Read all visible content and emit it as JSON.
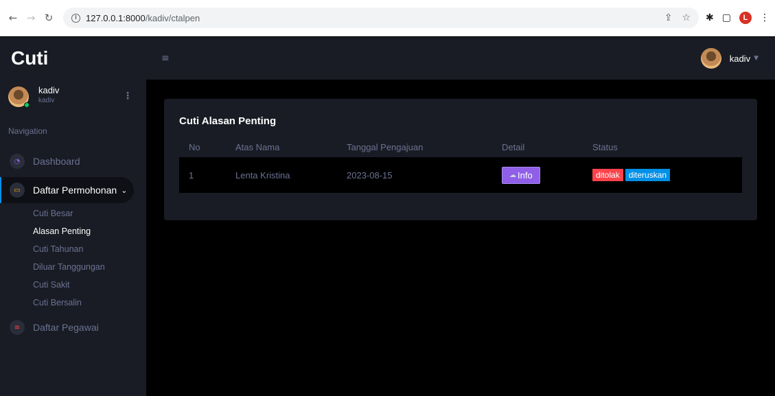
{
  "browser": {
    "url_host": "127.0.0.1:8000",
    "url_path": "/kadiv/ctalpen",
    "profile_initial": "L"
  },
  "app": {
    "brand": "Cuti"
  },
  "profile": {
    "name": "kadiv",
    "role": "kadiv"
  },
  "sidebar": {
    "heading": "Navigation",
    "items": [
      {
        "label": "Dashboard",
        "icon": "speedometer-icon",
        "color": "#8f5fe8"
      },
      {
        "label": "Daftar Permohonan",
        "icon": "laptop-icon",
        "color": "#ffab00",
        "expanded": true
      },
      {
        "label": "Daftar Pegawai",
        "icon": "list-icon",
        "color": "#fc424a"
      }
    ],
    "sub_items": [
      "Cuti Besar",
      "Alasan Penting",
      "Cuti Tahunan",
      "Diluar Tanggungan",
      "Cuti Sakit",
      "Cuti Bersalin"
    ],
    "current_sub_item": "Alasan Penting"
  },
  "topbar": {
    "user_name": "kadiv"
  },
  "card": {
    "title": "Cuti Alasan Penting",
    "columns": [
      "No",
      "Atas Nama",
      "Tanggal Pengajuan",
      "Detail",
      "Status"
    ],
    "rows": [
      {
        "no": "1",
        "name": "Lenta Kristina",
        "date": "2023-08-15",
        "detail_label": "Info",
        "status_rejected": "ditolak",
        "status_forwarded": "diteruskan"
      }
    ]
  },
  "colors": {
    "accent_purple": "#8f5fe8",
    "danger": "#fc424a",
    "info": "#0090e7",
    "sidebar_bg": "#191c24"
  }
}
